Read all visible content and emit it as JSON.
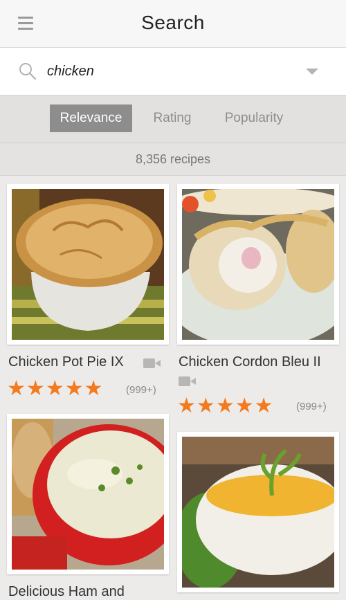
{
  "header": {
    "title": "Search"
  },
  "search": {
    "query": "chicken"
  },
  "sort": {
    "tabs": [
      {
        "label": "Relevance",
        "active": true
      },
      {
        "label": "Rating",
        "active": false
      },
      {
        "label": "Popularity",
        "active": false
      }
    ]
  },
  "results": {
    "count_label": "8,356 recipes",
    "cards": [
      {
        "name": "Chicken Pot Pie IX",
        "rating_stars": 5,
        "rating_count": "(999+)",
        "has_video": true
      },
      {
        "name": "Chicken Cordon Bleu II",
        "rating_stars": 5,
        "rating_count": "(999+)",
        "has_video": true
      },
      {
        "name": "Delicious Ham and",
        "has_video": false
      },
      {
        "name": "",
        "has_video": false
      }
    ]
  },
  "colors": {
    "accent_star": "#f37a1f",
    "active_tab": "#8d8d8d"
  }
}
